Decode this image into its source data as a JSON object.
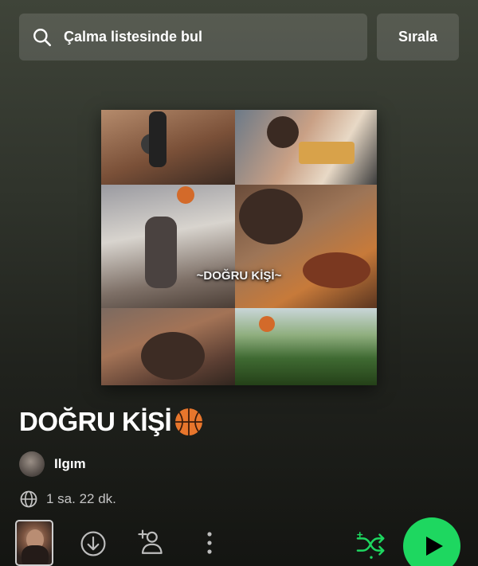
{
  "search": {
    "placeholder": "Çalma listesinde bul",
    "icon": "search-icon"
  },
  "sort": {
    "label": "Sırala"
  },
  "cover": {
    "overlay_text": "~DOĞRU KİŞİ~"
  },
  "playlist": {
    "title": "DOĞRU KİŞİ",
    "title_emoji": "basketball-icon",
    "owner": "Ilgım",
    "duration": "1 sa. 22 dk.",
    "visibility_icon": "globe-icon"
  },
  "controls": {
    "download_icon": "download-icon",
    "add_user_icon": "add-user-icon",
    "more_icon": "more-vertical-icon",
    "shuffle_icon": "shuffle-icon",
    "play_icon": "play-icon"
  },
  "colors": {
    "accent": "#1ed760",
    "background_top": "#3f4439",
    "background_bottom": "#141512"
  }
}
